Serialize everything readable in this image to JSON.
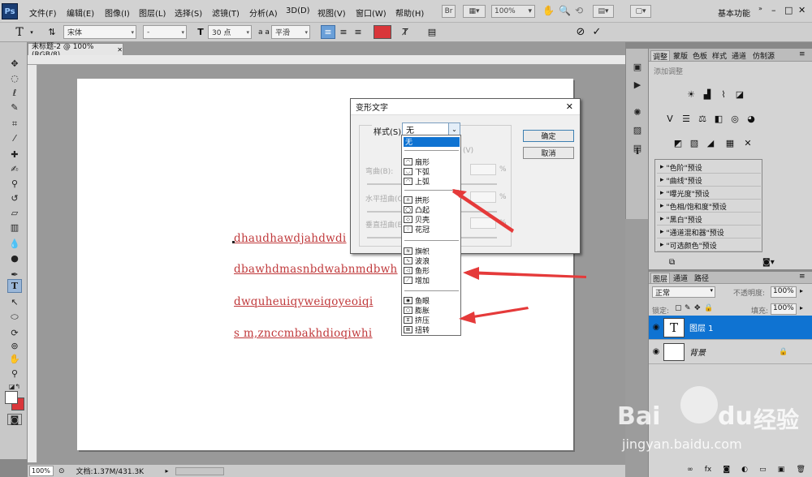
{
  "app": {
    "logo": "Ps"
  },
  "menu": {
    "items": [
      "文件(F)",
      "编辑(E)",
      "图像(I)",
      "图层(L)",
      "选择(S)",
      "滤镜(T)",
      "分析(A)",
      "3D(D)",
      "视图(V)",
      "窗口(W)",
      "帮助(H)"
    ],
    "zoom": "100%",
    "workspace": "基本功能"
  },
  "options": {
    "font_family": "宋体",
    "font_style": "-",
    "font_size": "30 点",
    "aa_label": "a a",
    "antialias": "平滑",
    "text_color": "#d9363a"
  },
  "document": {
    "tab_title": "未标题-2 @ 100%(RGB/8)",
    "lines": [
      "dhaudhawdjahdwdi",
      "dbawhdmasnbdwabnmdbwh",
      "dwquheuiqyweiqoyeoiqi",
      "s m,znccmbakhdioqiwhi"
    ]
  },
  "status": {
    "zoom": "100%",
    "doc_info": "文档:1.37M/431.3K"
  },
  "dialog": {
    "title": "变形文字",
    "style_label": "样式(S):",
    "style_value": "无",
    "ok": "确定",
    "cancel": "取消",
    "vertical_label": "(V)",
    "bend_label": "弯曲(B):",
    "h_distort_label": "水平扭曲(O)",
    "v_distort_label": "垂直扭曲(E)",
    "percent": "%"
  },
  "dropdown": {
    "options": [
      "无",
      "扇形",
      "下弧",
      "上弧",
      "拱形",
      "凸起",
      "贝壳",
      "花冠",
      "旗帜",
      "波浪",
      "鱼形",
      "增加",
      "鱼眼",
      "膨胀",
      "挤压",
      "扭转"
    ],
    "selected": "无"
  },
  "adjustments": {
    "tabs": [
      "调整",
      "蒙版",
      "色板",
      "样式",
      "通道",
      "仿制源"
    ],
    "hint": "添加调整",
    "presets": [
      "\"色阶\"预设",
      "\"曲线\"预设",
      "\"曝光度\"预设",
      "\"色相/饱和度\"预设",
      "\"黑白\"预设",
      "\"通道混和器\"预设",
      "\"可选颜色\"预设"
    ]
  },
  "layers": {
    "tabs": [
      "图层",
      "通道",
      "路径"
    ],
    "blend_mode": "正常",
    "opacity_label": "不透明度:",
    "opacity": "100%",
    "lock_label": "锁定:",
    "fill_label": "填充:",
    "fill": "100%",
    "items": [
      {
        "name": "图层 1",
        "thumb": "T",
        "selected": true
      },
      {
        "name": "背景",
        "thumb": "",
        "selected": false
      }
    ],
    "bottom_icons": [
      "link-icon",
      "fx-icon",
      "mask-icon",
      "adjustment-icon",
      "folder-icon",
      "new-layer-icon",
      "trash-icon"
    ]
  },
  "watermark": {
    "line1": "Bai",
    "line2": "du",
    "line3": "经验",
    "url": "jingyan.baidu.com"
  },
  "colors": {
    "selection": "#0f73d2",
    "arrow": "#e53a3a"
  }
}
